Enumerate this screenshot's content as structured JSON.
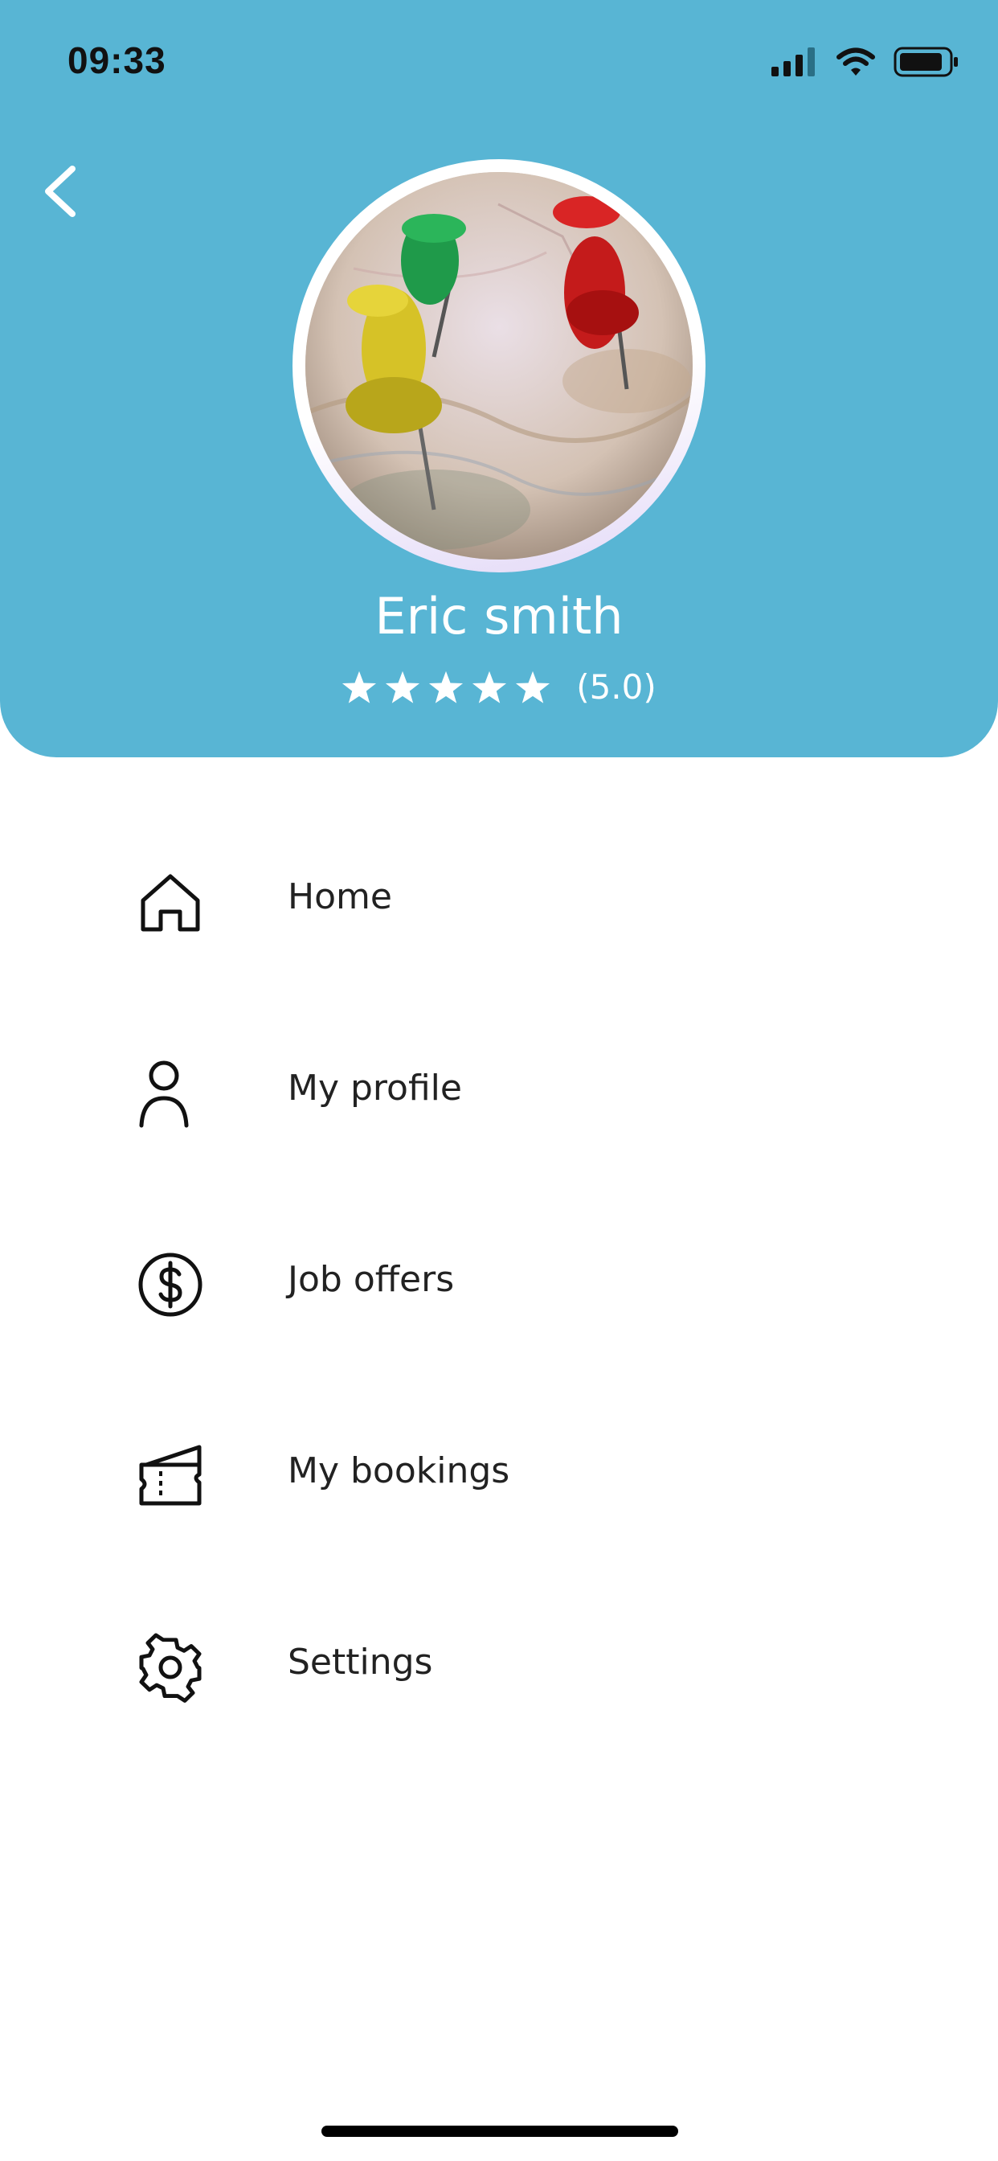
{
  "status_bar": {
    "time": "09:33"
  },
  "profile": {
    "name": "Eric smith",
    "rating": 5.0,
    "rating_text": "(5.0)",
    "stars": 5
  },
  "menu": [
    {
      "label": "Home",
      "icon": "home-icon"
    },
    {
      "label": "My profile",
      "icon": "user-icon"
    },
    {
      "label": "Job offers",
      "icon": "dollar-icon"
    },
    {
      "label": "My bookings",
      "icon": "ticket-icon"
    },
    {
      "label": "Settings",
      "icon": "gear-icon"
    }
  ],
  "colors": {
    "header": "#58B5D4",
    "menu_text": "#222222",
    "header_text": "#ffffff"
  }
}
